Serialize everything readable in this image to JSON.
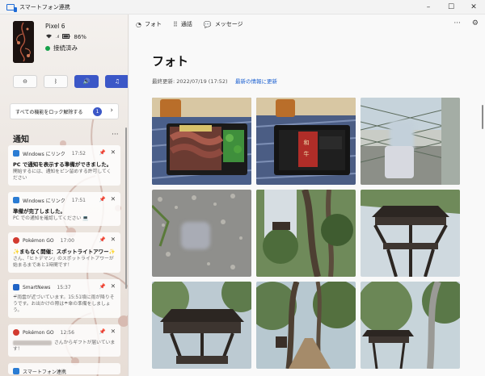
{
  "window": {
    "title": "スマートフォン連携",
    "minimize": "–",
    "maximize": "☐",
    "close": "✕"
  },
  "device": {
    "name": "Pixel 6",
    "battery": "86%",
    "connection": "接続済み"
  },
  "quick_actions": [
    {
      "name": "dnd-button",
      "icon": "minus-circle-icon",
      "glyph": "⊖",
      "active": false
    },
    {
      "name": "bluetooth-button",
      "icon": "bluetooth-icon",
      "glyph": "ᛒ",
      "active": false
    },
    {
      "name": "volume-button",
      "icon": "speaker-icon",
      "glyph": "🔊",
      "active": true
    },
    {
      "name": "media-button",
      "icon": "music-icon",
      "glyph": "♫",
      "active": true
    }
  ],
  "lock_bar": {
    "label": "すべての機能をロック解除する",
    "badge": "1",
    "chevron": "›"
  },
  "notifications": {
    "heading": "通知",
    "more": "···",
    "items": [
      {
        "app": "Windows にリンク",
        "time": "17:52",
        "title": "PC で通知を表示する準備ができました。",
        "body": "開始するには、通知をピン留めする許可してください",
        "icon_color": "#2b7cd3"
      },
      {
        "app": "Windows にリンク",
        "time": "17:51",
        "title": "準備が完了しました。",
        "body": "PC での通知を確認してください 💻",
        "icon_color": "#2b7cd3"
      },
      {
        "app": "Pokémon GO",
        "time": "17:00",
        "title": "✨まもなく開催：スポットライトアワー✨",
        "body": "さん、「ヒトデマン」のスポットライトアワーが始まるまであと1時間です！",
        "icon_color": "#d23a2f"
      },
      {
        "app": "SmartNews",
        "time": "15:37",
        "title": "",
        "body": "☔雨雲が近づいています。15:51頃に雨が降りそうです。お出かけの際は☂傘の準備をしましょう。",
        "icon_color": "#1f63c5"
      },
      {
        "app": "Pokémon GO",
        "time": "12:56",
        "title": "",
        "body": "さんからギフトが届いています！",
        "icon_color": "#d23a2f",
        "blurred_sender": true
      },
      {
        "app": "スマートフォン連携",
        "time": "",
        "title": "",
        "body": "",
        "icon_color": "#2b7cd3"
      }
    ],
    "pin_glyph": "📌",
    "close_glyph": "✕"
  },
  "topnav": {
    "tabs": [
      {
        "label": "フォト",
        "icon": "photos-icon",
        "glyph": "◔"
      },
      {
        "label": "通話",
        "icon": "dialpad-icon",
        "glyph": "⠿"
      },
      {
        "label": "メッセージ",
        "icon": "message-icon",
        "glyph": "💬"
      }
    ],
    "more": "···",
    "settings": "⚙"
  },
  "photos": {
    "title": "フォト",
    "last_updated": "最終更新: 2022/07/19 (17:52)",
    "refresh_link": "最新の情報に更新",
    "items": [
      {
        "kind": "bento-steak"
      },
      {
        "kind": "bento-box"
      },
      {
        "kind": "fence-blur"
      },
      {
        "kind": "gravel-blur"
      },
      {
        "kind": "tower-trees"
      },
      {
        "kind": "tower-closeup"
      },
      {
        "kind": "tower-low"
      },
      {
        "kind": "forest-path"
      },
      {
        "kind": "forest-tower"
      }
    ]
  }
}
